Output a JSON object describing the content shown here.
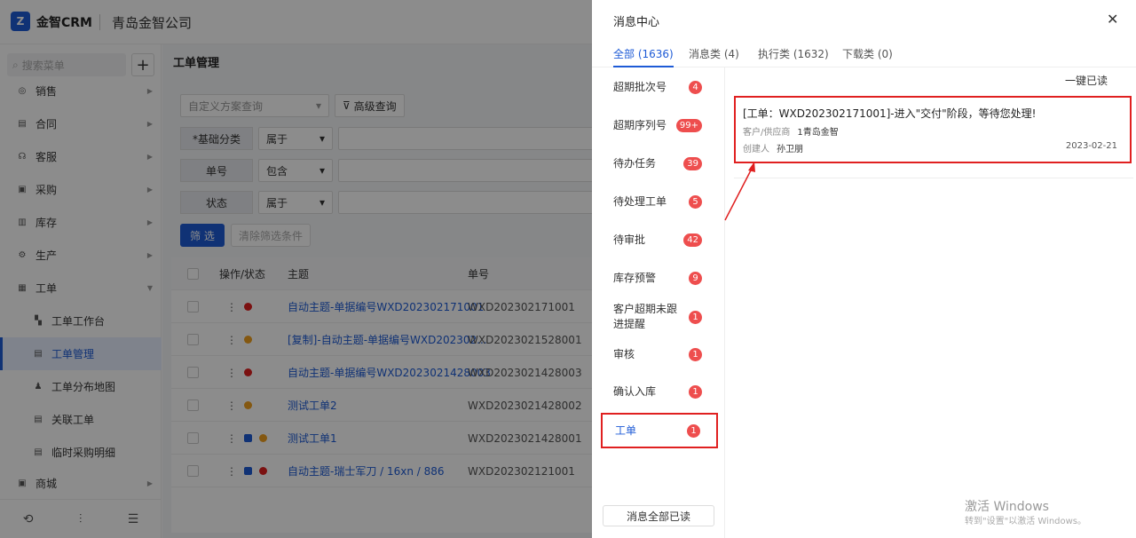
{
  "app": {
    "logo_text": "金智CRM",
    "logo_mark": "Z",
    "company": "青岛金智公司"
  },
  "sidebar": {
    "search_placeholder": "搜索菜单",
    "items": [
      {
        "label": "销售",
        "icon": "sales-icon"
      },
      {
        "label": "合同",
        "icon": "contract-icon"
      },
      {
        "label": "客服",
        "icon": "service-icon"
      },
      {
        "label": "采购",
        "icon": "purchase-icon"
      },
      {
        "label": "库存",
        "icon": "inventory-icon"
      },
      {
        "label": "生产",
        "icon": "production-icon"
      },
      {
        "label": "工单",
        "icon": "workorder-icon"
      },
      {
        "label": "工单工作台",
        "icon": "workbench-icon"
      },
      {
        "label": "工单管理",
        "icon": "workorder-manage-icon"
      },
      {
        "label": "工单分布地图",
        "icon": "map-icon"
      },
      {
        "label": "关联工单",
        "icon": "related-icon"
      },
      {
        "label": "临时采购明细",
        "icon": "temp-purchase-icon"
      },
      {
        "label": "商城",
        "icon": "mall-icon"
      }
    ]
  },
  "main": {
    "page_title": "工单管理",
    "scheme_placeholder": "自定义方案查询",
    "advanced_query": "高级查询",
    "filters": [
      {
        "label": "*基础分类",
        "op": "属于"
      },
      {
        "label": "单号",
        "op": "包含"
      },
      {
        "label": "状态",
        "op": "属于"
      }
    ],
    "filter_button": "筛 选",
    "clear_button": "清除筛选条件",
    "table": {
      "headers": [
        "操作/状态",
        "主题",
        "单号"
      ],
      "rows": [
        {
          "subject": "自动主题-单据编号WXD202302171001",
          "no": "WXD202302171001"
        },
        {
          "subject": "[复制]-自动主题-单据编号WXD202302...",
          "no": "WXD2023021528001"
        },
        {
          "subject": "自动主题-单据编号WXD2023021428003",
          "no": "WXD2023021428003"
        },
        {
          "subject": "测试工单2",
          "no": "WXD2023021428002"
        },
        {
          "subject": "测试工单1",
          "no": "WXD2023021428001"
        },
        {
          "subject": "自动主题-瑞士军刀 / 16xn / 886",
          "no": "WXD202302121001"
        }
      ]
    }
  },
  "drawer": {
    "title": "消息中心",
    "tabs": [
      "全部 (1636)",
      "消息类 (4)",
      "执行类 (1632)",
      "下载类 (0)"
    ],
    "categories": [
      {
        "label": "超期批次号",
        "count": "4"
      },
      {
        "label": "超期序列号",
        "count": "99+"
      },
      {
        "label": "待办任务",
        "count": "39"
      },
      {
        "label": "待处理工单",
        "count": "5"
      },
      {
        "label": "待审批",
        "count": "42"
      },
      {
        "label": "库存预警",
        "count": "9"
      },
      {
        "label": "客户超期未跟进提醒",
        "count": "1"
      },
      {
        "label": "审核",
        "count": "1"
      },
      {
        "label": "确认入库",
        "count": "1"
      },
      {
        "label": "工单",
        "count": "1"
      }
    ],
    "read_all_button": "消息全部已读",
    "one_key_read": "一键已读",
    "message": {
      "title": "[工单：WXD202302171001]-进入\"交付\"阶段，等待您处理!",
      "customer_label": "客户/供应商",
      "customer_value": "1青岛金智",
      "creator_label": "创建人",
      "creator_value": "孙卫朋",
      "date": "2023-02-21"
    }
  },
  "watermark": {
    "line1": "激活 Windows",
    "line2": "转到\"设置\"以激活 Windows。"
  },
  "colors": {
    "accent": "#1e5bd6",
    "badge": "#ee4e4e",
    "highlight": "#e02020"
  }
}
